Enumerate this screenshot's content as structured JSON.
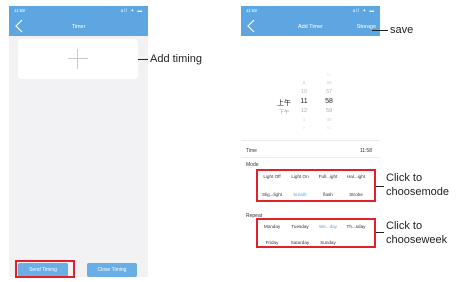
{
  "colors": {
    "accent": "#5da6e2",
    "highlight": "#e0202a"
  },
  "timer_screen": {
    "status": {
      "time": "11:58",
      "icons": "all ✦ ▬"
    },
    "header": {
      "back_icon": "chevron-left-icon",
      "title": "Timer"
    },
    "add_icon": "plus-icon",
    "buttons": {
      "send": "Send Timing",
      "close": "Close Timing"
    }
  },
  "add_timer_screen": {
    "status": {
      "time": "11:58",
      "icons": "all ✦ ▬"
    },
    "header": {
      "back_icon": "chevron-left-icon",
      "title": "Add Timer",
      "save": "Storage"
    },
    "picker": {
      "rows": [
        {
          "ampm": "",
          "hour": "",
          "minute": "55"
        },
        {
          "ampm": "",
          "hour": "9",
          "minute": "56"
        },
        {
          "ampm": "",
          "hour": "10",
          "minute": "57"
        },
        {
          "ampm": "上午",
          "hour": "11",
          "minute": "58"
        },
        {
          "ampm": "下午",
          "hour": "12",
          "minute": "59"
        },
        {
          "ampm": "",
          "hour": "1",
          "minute": "00"
        },
        {
          "ampm": "",
          "hour": "2",
          "minute": "01"
        }
      ]
    },
    "time": {
      "label": "Time",
      "value": "11:58"
    },
    "mode": {
      "label": "Mode",
      "options_row1": [
        "Light Off",
        "Light On",
        "Full...ight",
        "Hal...ight"
      ],
      "options_row2": [
        "Slig...light",
        "breath",
        "flash",
        "Strobe"
      ],
      "selected": "breath"
    },
    "repeat": {
      "label": "Repeat",
      "days_row1": [
        "Monday",
        "Tuesday",
        "We...day",
        "Th...sday"
      ],
      "days_row2": [
        "Friday",
        "Saturday",
        "Sunday"
      ],
      "selected": "We...day"
    }
  },
  "annotations": {
    "add_timing": "Add timing",
    "save": "save",
    "mode_line1": "Click to",
    "mode_line2": "choosemode",
    "week_line1": "Click to",
    "week_line2": "chooseweek"
  }
}
